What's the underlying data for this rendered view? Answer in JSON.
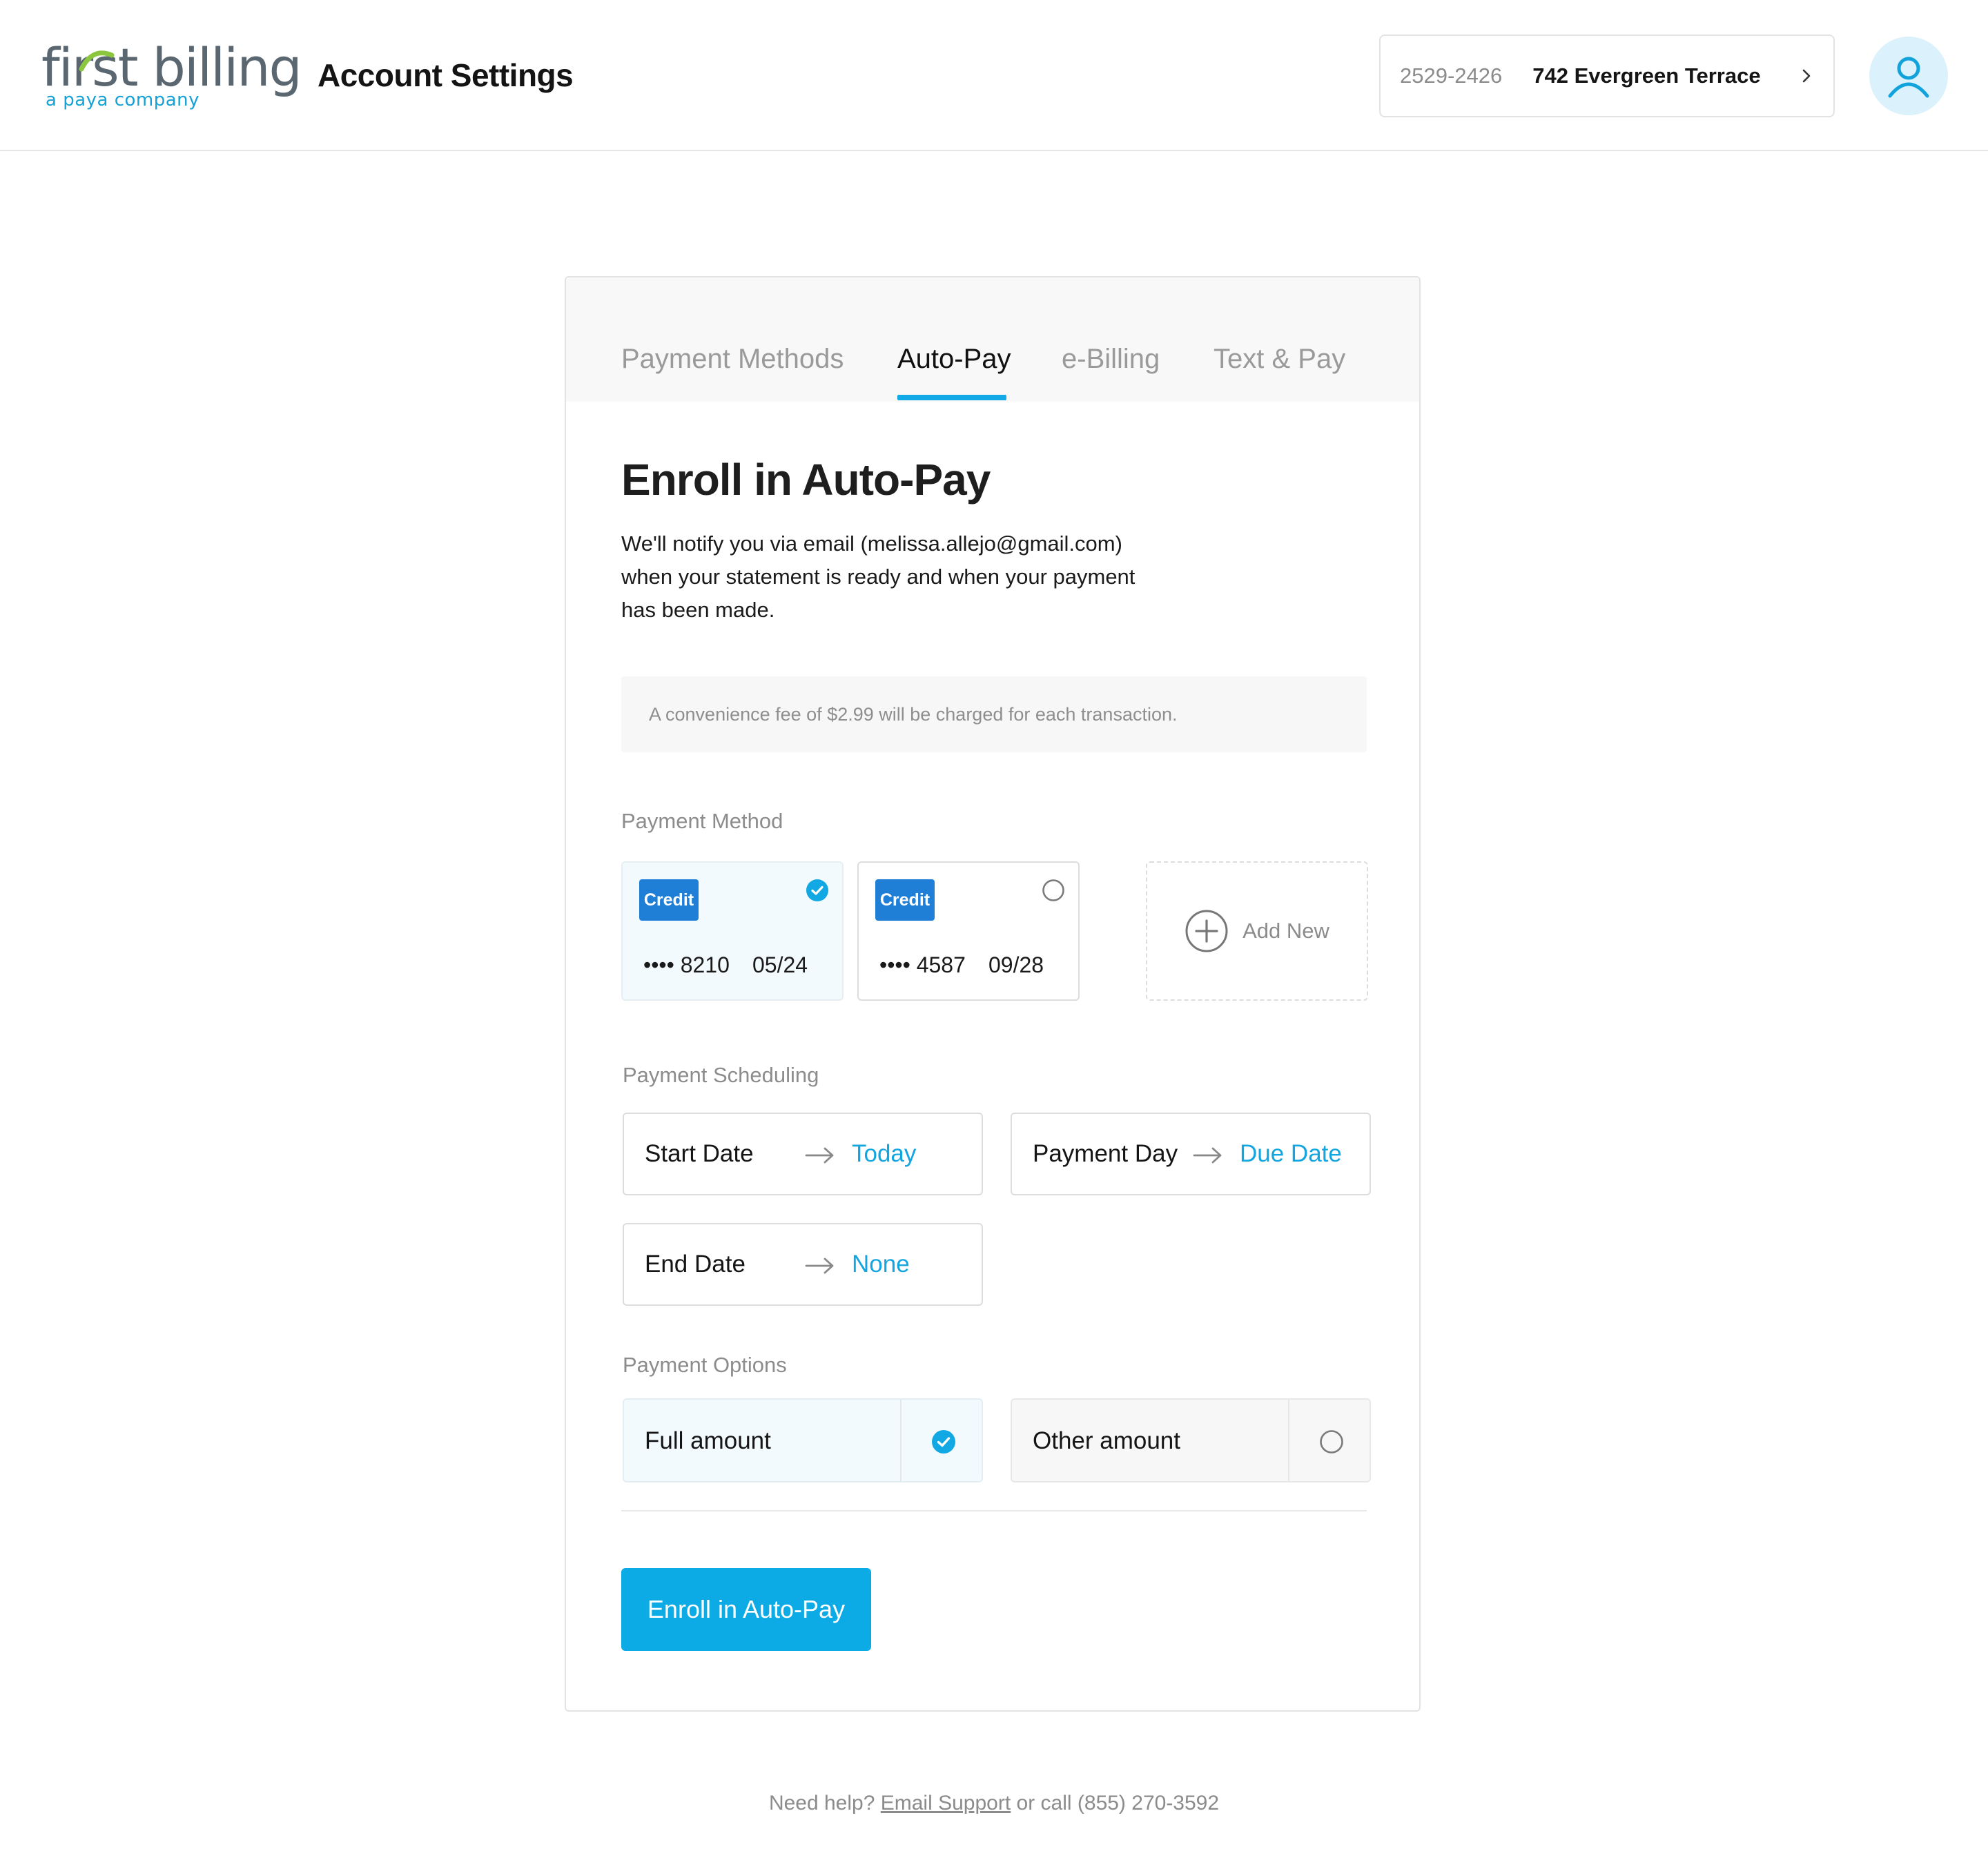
{
  "brand": {
    "logo_main": "first billing",
    "logo_sub": "a paya company"
  },
  "header": {
    "title": "Account Settings",
    "account_number": "2529-2426",
    "account_address": "742 Evergreen Terrace"
  },
  "tabs": [
    {
      "label": "Payment Methods",
      "active": false
    },
    {
      "label": "Auto-Pay",
      "active": true
    },
    {
      "label": "e-Billing",
      "active": false
    },
    {
      "label": "Text & Pay",
      "active": false
    }
  ],
  "main": {
    "heading": "Enroll in Auto-Pay",
    "notify_text": "We'll notify you via email (melissa.allejo@gmail.com) when your statement is ready and when your payment has been made.",
    "fee_notice": "A convenience fee of $2.99 will be charged for each transaction."
  },
  "payment_method": {
    "label": "Payment Method",
    "cards": [
      {
        "type": "Credit",
        "number": "•••• 8210",
        "expiry": "05/24",
        "selected": true
      },
      {
        "type": "Credit",
        "number": "•••• 4587",
        "expiry": "09/28",
        "selected": false
      }
    ],
    "add_new": "Add New"
  },
  "scheduling": {
    "label": "Payment Scheduling",
    "start": {
      "label": "Start Date",
      "value": "Today"
    },
    "payment_day": {
      "label": "Payment Day",
      "value": "Due Date"
    },
    "end": {
      "label": "End Date",
      "value": "None"
    }
  },
  "options": {
    "label": "Payment Options",
    "full": {
      "label": "Full amount",
      "selected": true
    },
    "other": {
      "label": "Other amount",
      "selected": false
    }
  },
  "submit_label": "Enroll in Auto-Pay",
  "footer": {
    "prefix": "Need help?",
    "link": "Email Support",
    "suffix": "or call (855) 270-3592"
  },
  "colors": {
    "accent": "#0cabe6",
    "badge": "#1f7fd6",
    "logo_gray": "#5b6770"
  }
}
